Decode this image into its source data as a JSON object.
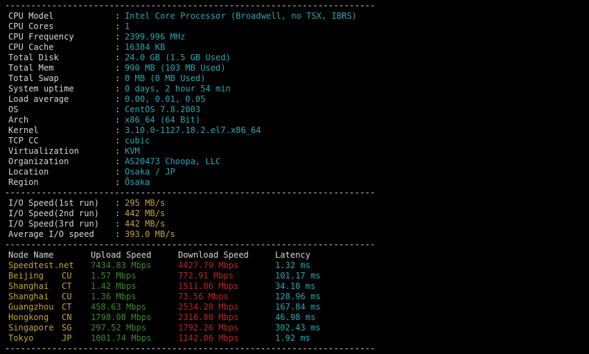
{
  "separator": "-----------------------------------------------------------------------",
  "sysinfo": [
    {
      "label": "CPU Model",
      "value": "Intel Core Processor (Broadwell, no TSX, IBRS)"
    },
    {
      "label": "CPU Cores",
      "value": "1"
    },
    {
      "label": "CPU Frequency",
      "value": "2399.996 MHz"
    },
    {
      "label": "CPU Cache",
      "value": "16384 KB"
    },
    {
      "label": "Total Disk",
      "value": "24.0 GB (1.5 GB Used)"
    },
    {
      "label": "Total Mem",
      "value": "990 MB (103 MB Used)"
    },
    {
      "label": "Total Swap",
      "value": "0 MB (0 MB Used)"
    },
    {
      "label": "System uptime",
      "value": "0 days, 2 hour 54 min"
    },
    {
      "label": "Load average",
      "value": "0.00, 0.01, 0.05"
    },
    {
      "label": "OS",
      "value": "CentOS 7.8.2003"
    },
    {
      "label": "Arch",
      "value": "x86_64 (64 Bit)"
    },
    {
      "label": "Kernel",
      "value": "3.10.0-1127.18.2.el7.x86_64"
    },
    {
      "label": "TCP CC",
      "value": "cubic"
    },
    {
      "label": "Virtualization",
      "value": "KVM"
    },
    {
      "label": "Organization",
      "value": "AS20473 Choopa, LLC"
    },
    {
      "label": "Location",
      "value": "Osaka / JP"
    },
    {
      "label": "Region",
      "value": "Ōsaka"
    }
  ],
  "io": [
    {
      "label": "I/O Speed(1st run)",
      "value": "295 MB/s"
    },
    {
      "label": "I/O Speed(2nd run)",
      "value": "442 MB/s"
    },
    {
      "label": "I/O Speed(3rd run)",
      "value": "442 MB/s"
    },
    {
      "label": "Average I/O speed",
      "value": "393.0 MB/s"
    }
  ],
  "speed_header": {
    "node": "Node Name",
    "upload": "Upload Speed",
    "download": "Download Speed",
    "latency": "Latency"
  },
  "speed_rows": [
    {
      "node": "Speedtest.net",
      "isp": "",
      "upload": "7434.83 Mbps",
      "download": "4427.79 Mbps",
      "latency": "1.32 ms"
    },
    {
      "node": "Beijing",
      "isp": "CU",
      "upload": "1.57 Mbps",
      "download": "772.91 Mbps",
      "latency": "101.17 ms"
    },
    {
      "node": "Shanghai",
      "isp": "CT",
      "upload": "1.42 Mbps",
      "download": "1511.06 Mbps",
      "latency": "34.10 ms"
    },
    {
      "node": "Shanghai",
      "isp": "CU",
      "upload": "1.36 Mbps",
      "download": "73.56 Mbps",
      "latency": "128.96 ms"
    },
    {
      "node": "Guangzhou",
      "isp": "CT",
      "upload": "458.63 Mbps",
      "download": "2534.28 Mbps",
      "latency": "167.84 ms"
    },
    {
      "node": "Hongkong",
      "isp": "CN",
      "upload": "1798.08 Mbps",
      "download": "2316.88 Mbps",
      "latency": "46.98 ms"
    },
    {
      "node": "Singapore",
      "isp": "SG",
      "upload": "297.52 Mbps",
      "download": "1792.26 Mbps",
      "latency": "302.43 ms"
    },
    {
      "node": "Tokyo",
      "isp": "JP",
      "upload": "1001.74 Mbps",
      "download": "1142.06 Mbps",
      "latency": "1.92 ms"
    }
  ],
  "colors": {
    "background": "#000000",
    "label": "#d8d8d8",
    "value": "#2aa6b4",
    "io_value": "#c6a43a",
    "node": "#c6a43a",
    "upload": "#3a8a2e",
    "download": "#b8261f",
    "latency": "#2aa6b4"
  }
}
